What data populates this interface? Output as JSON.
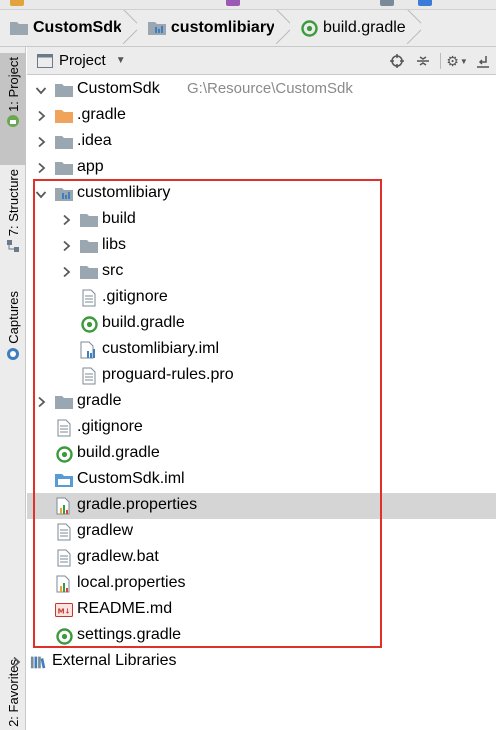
{
  "breadcrumb": {
    "items": [
      {
        "label": "CustomSdk",
        "icon": "folder-icon"
      },
      {
        "label": "customlibiary",
        "icon": "module-folder-icon"
      },
      {
        "label": "build.gradle",
        "icon": "gradle-icon"
      }
    ]
  },
  "sidebar": {
    "tabs": [
      {
        "label": "1: Project",
        "icon": "android-icon",
        "active": true
      },
      {
        "label": "7: Structure",
        "icon": "structure-icon",
        "active": false
      },
      {
        "label": "Captures",
        "icon": "camera-icon",
        "active": false
      },
      {
        "label": "2: Favorites",
        "icon": "star-icon",
        "active": false
      }
    ]
  },
  "panel": {
    "title": "Project",
    "tools": [
      "target-icon",
      "collapse-icon",
      "gear-icon",
      "hide-icon"
    ]
  },
  "tree": {
    "root": {
      "label": "CustomSdk",
      "path": "G:\\Resource\\CustomSdk"
    },
    "items": [
      {
        "label": ".gradle",
        "icon": "orange-folder-icon",
        "depth": 1,
        "expandable": true,
        "expanded": false
      },
      {
        "label": ".idea",
        "icon": "folder-icon",
        "depth": 1,
        "expandable": true,
        "expanded": false
      },
      {
        "label": "app",
        "icon": "folder-icon",
        "depth": 1,
        "expandable": true,
        "expanded": false
      },
      {
        "label": "customlibiary",
        "icon": "module-folder-icon",
        "depth": 1,
        "expandable": true,
        "expanded": true
      },
      {
        "label": "build",
        "icon": "folder-icon",
        "depth": 2,
        "expandable": true,
        "expanded": false
      },
      {
        "label": "libs",
        "icon": "folder-icon",
        "depth": 2,
        "expandable": true,
        "expanded": false
      },
      {
        "label": "src",
        "icon": "folder-icon",
        "depth": 2,
        "expandable": true,
        "expanded": false
      },
      {
        "label": ".gitignore",
        "icon": "text-file-icon",
        "depth": 2,
        "expandable": false
      },
      {
        "label": "build.gradle",
        "icon": "gradle-icon",
        "depth": 2,
        "expandable": false
      },
      {
        "label": "customlibiary.iml",
        "icon": "iml-file-icon",
        "depth": 2,
        "expandable": false
      },
      {
        "label": "proguard-rules.pro",
        "icon": "text-file-icon",
        "depth": 2,
        "expandable": false
      },
      {
        "label": "gradle",
        "icon": "folder-icon",
        "depth": 1,
        "expandable": true,
        "expanded": false
      },
      {
        "label": ".gitignore",
        "icon": "text-file-icon",
        "depth": 1,
        "expandable": false
      },
      {
        "label": "build.gradle",
        "icon": "gradle-icon",
        "depth": 1,
        "expandable": false
      },
      {
        "label": "CustomSdk.iml",
        "icon": "iml-module-icon",
        "depth": 1,
        "expandable": false
      },
      {
        "label": "gradle.properties",
        "icon": "properties-file-icon",
        "depth": 1,
        "expandable": false,
        "selected": true
      },
      {
        "label": "gradlew",
        "icon": "text-file-icon",
        "depth": 1,
        "expandable": false
      },
      {
        "label": "gradlew.bat",
        "icon": "text-file-icon",
        "depth": 1,
        "expandable": false
      },
      {
        "label": "local.properties",
        "icon": "properties-file-icon",
        "depth": 1,
        "expandable": false
      },
      {
        "label": "README.md",
        "icon": "markdown-file-icon",
        "depth": 1,
        "expandable": false
      },
      {
        "label": "settings.gradle",
        "icon": "gradle-icon",
        "depth": 1,
        "expandable": false
      }
    ],
    "external": {
      "label": "External Libraries",
      "icon": "libraries-icon"
    }
  },
  "colors": {
    "highlight": "#e0302a",
    "selection": "#d5d5d5",
    "folder": "#9aa7b0",
    "gradle": "#3c9a3c"
  }
}
